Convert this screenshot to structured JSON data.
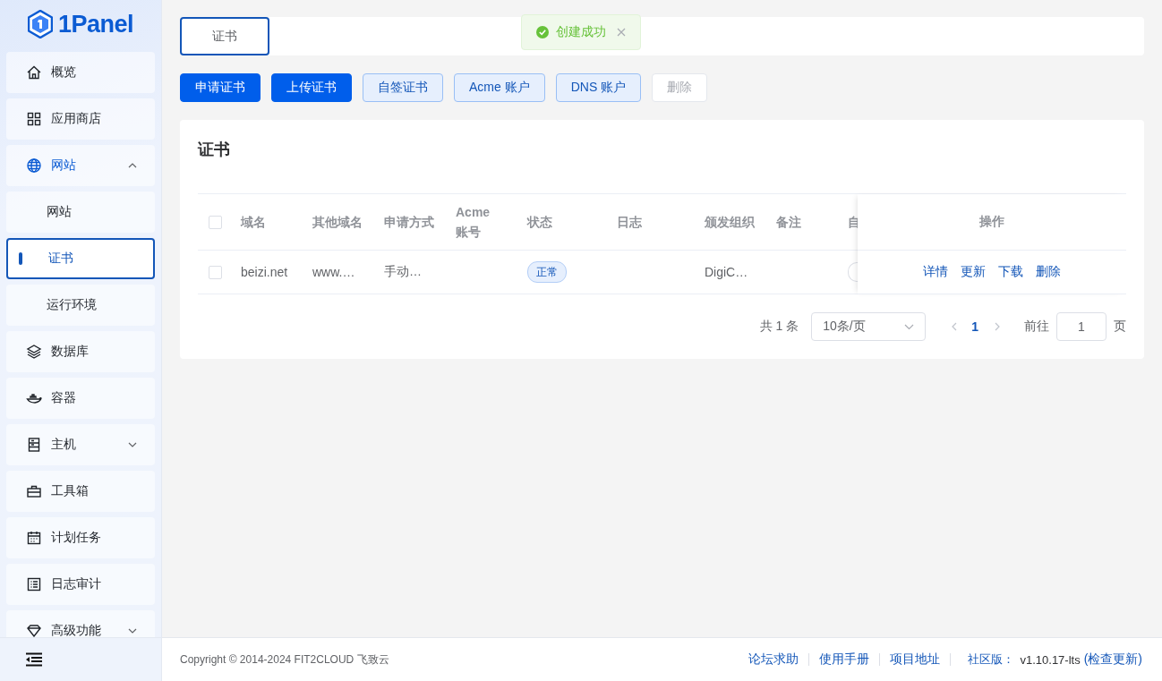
{
  "logo": {
    "text": "1Panel"
  },
  "sidebar": {
    "items": [
      {
        "label": "概览",
        "selected": false
      },
      {
        "label": "应用商店",
        "selected": false
      },
      {
        "label": "网站",
        "expanded": true,
        "selected": true,
        "children": [
          {
            "label": "网站",
            "selected": false
          },
          {
            "label": "证书",
            "selected": true
          },
          {
            "label": "运行环境",
            "selected": false
          }
        ]
      },
      {
        "label": "数据库",
        "selected": false
      },
      {
        "label": "容器",
        "selected": false
      },
      {
        "label": "主机",
        "expanded": false,
        "selected": false
      },
      {
        "label": "工具箱",
        "selected": false
      },
      {
        "label": "计划任务",
        "selected": false
      },
      {
        "label": "日志审计",
        "selected": false
      },
      {
        "label": "高级功能",
        "expanded": false,
        "selected": false
      }
    ]
  },
  "tabs": [
    {
      "label": "证书",
      "selected": true
    }
  ],
  "toast": {
    "text": "创建成功"
  },
  "toolbar": [
    {
      "label": "申请证书",
      "kind": "primary",
      "disabled": false
    },
    {
      "label": "上传证书",
      "kind": "primary",
      "disabled": false
    },
    {
      "label": "自签证书",
      "kind": "plain",
      "disabled": false
    },
    {
      "label": "Acme 账户",
      "kind": "plain",
      "disabled": false
    },
    {
      "label": "DNS 账户",
      "kind": "plain",
      "disabled": false
    },
    {
      "label": "删除",
      "kind": "default",
      "disabled": true
    }
  ],
  "card": {
    "title": "证书"
  },
  "table": {
    "select_all_checked": false,
    "columns": [
      "域名",
      "其他域名",
      "申请方式",
      "Acme 账号",
      "状态",
      "日志",
      "颁发组织",
      "备注",
      "自"
    ],
    "action_column": "操作",
    "rows": [
      {
        "checked": false,
        "cells": [
          "beizi.net",
          "www.…",
          "手动…",
          "",
          "正常",
          "",
          "DigiC…",
          ""
        ],
        "auto_renew": false,
        "actions": [
          "详情",
          "更新",
          "下载",
          "删除"
        ]
      }
    ]
  },
  "pagination": {
    "total": "共 1 条",
    "page_size": "10条/页",
    "pages": [
      {
        "label": "1",
        "selected": true
      }
    ],
    "goto_label": "前往",
    "goto_value": "1",
    "goto_suffix": "页"
  },
  "footer": {
    "copyright": "Copyright © 2014-2024 FIT2CLOUD 飞致云",
    "links": [
      "论坛求助",
      "使用手册",
      "项目地址"
    ],
    "edition": "社区版：",
    "version": "v1.10.17-lts",
    "update": "(检查更新)"
  }
}
